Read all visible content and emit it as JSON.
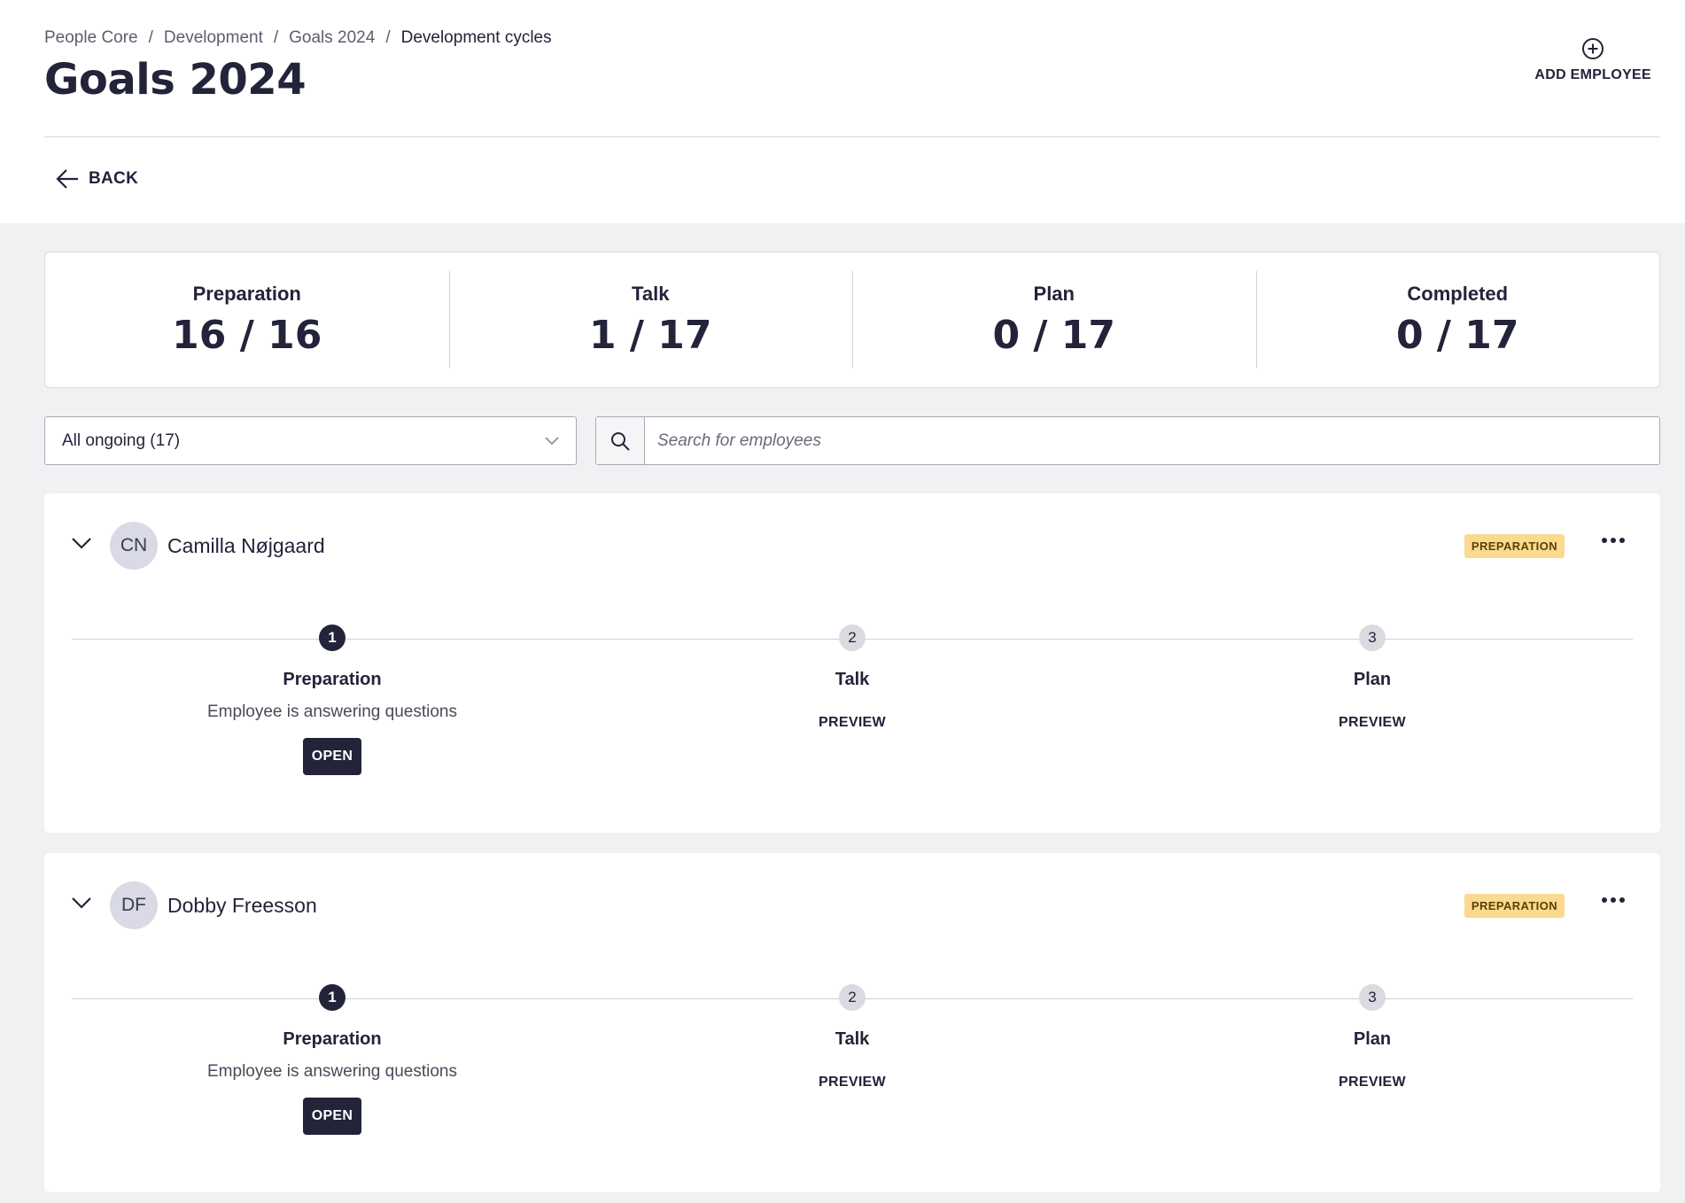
{
  "breadcrumb": [
    "People Core",
    "Development",
    "Goals 2024",
    "Development cycles"
  ],
  "page_title": "Goals 2024",
  "add_employee_label": "ADD EMPLOYEE",
  "back_label": "BACK",
  "stats": [
    {
      "label": "Preparation",
      "value": "16 / 16"
    },
    {
      "label": "Talk",
      "value": "1 / 17"
    },
    {
      "label": "Plan",
      "value": "0 / 17"
    },
    {
      "label": "Completed",
      "value": "0 / 17"
    }
  ],
  "filter": {
    "selected": "All ongoing (17)"
  },
  "search": {
    "placeholder": "Search for employees"
  },
  "employees": [
    {
      "initials": "CN",
      "name": "Camilla Nøjgaard",
      "status": "PREPARATION",
      "steps": [
        {
          "num": "1",
          "title": "Preparation",
          "desc": "Employee is answering questions",
          "action": "OPEN"
        },
        {
          "num": "2",
          "title": "Talk",
          "action": "PREVIEW"
        },
        {
          "num": "3",
          "title": "Plan",
          "action": "PREVIEW"
        }
      ]
    },
    {
      "initials": "DF",
      "name": "Dobby Freesson",
      "status": "PREPARATION",
      "steps": [
        {
          "num": "1",
          "title": "Preparation",
          "desc": "Employee is answering questions",
          "action": "OPEN"
        },
        {
          "num": "2",
          "title": "Talk",
          "action": "PREVIEW"
        },
        {
          "num": "3",
          "title": "Plan",
          "action": "PREVIEW"
        }
      ]
    }
  ],
  "colors": {
    "primary": "#23233a",
    "badge": "#fbd98e",
    "background": "#f1f1f3"
  }
}
